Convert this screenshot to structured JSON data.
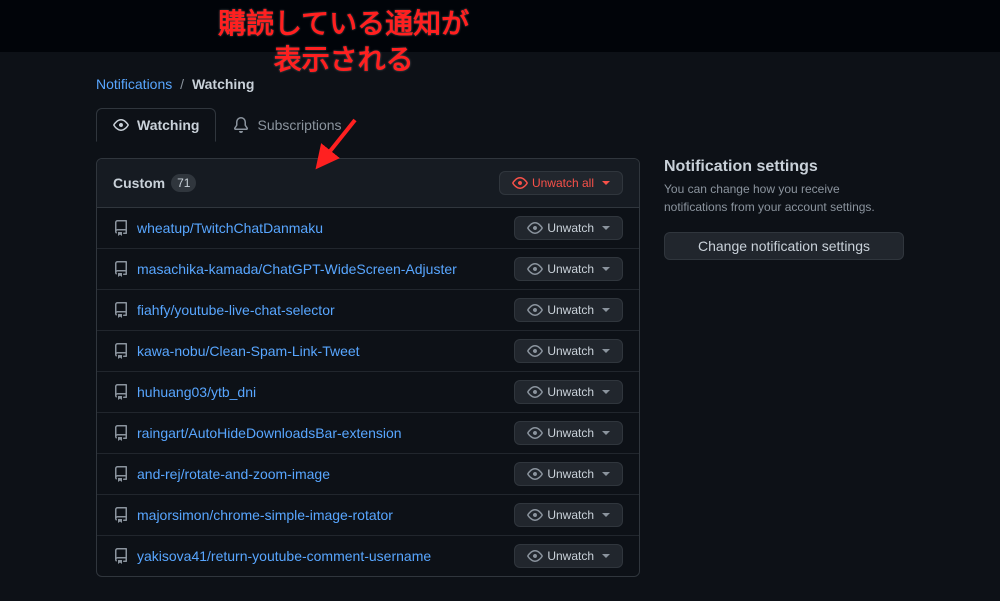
{
  "annotation": {
    "line1": "購読している通知が",
    "line2": "表示される"
  },
  "breadcrumb": {
    "parent": "Notifications",
    "current": "Watching"
  },
  "tabs": {
    "watching": "Watching",
    "subscriptions": "Subscriptions"
  },
  "list": {
    "header_title": "Custom",
    "count": "71",
    "unwatch_all": "Unwatch all",
    "unwatch_label": "Unwatch",
    "repos": [
      "wheatup/TwitchChatDanmaku",
      "masachika-kamada/ChatGPT-WideScreen-Adjuster",
      "fiahfy/youtube-live-chat-selector",
      "kawa-nobu/Clean-Spam-Link-Tweet",
      "huhuang03/ytb_dni",
      "raingart/AutoHideDownloadsBar-extension",
      "and-rej/rotate-and-zoom-image",
      "majorsimon/chrome-simple-image-rotator",
      "yakisova41/return-youtube-comment-username"
    ]
  },
  "sidebar": {
    "title": "Notification settings",
    "desc": "You can change how you receive notifications from your account settings.",
    "button": "Change notification settings"
  }
}
